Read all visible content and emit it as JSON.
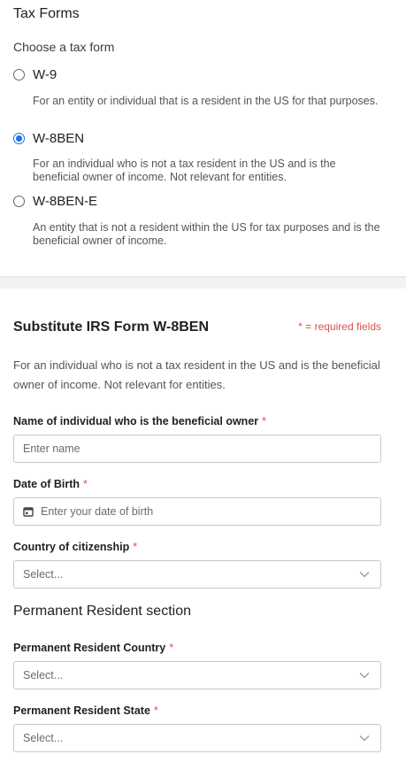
{
  "tax_forms": {
    "title": "Tax Forms",
    "prompt": "Choose a tax form",
    "options": [
      {
        "label": "W-9",
        "description": "For an entity or individual that is a resident in the US for that purposes.",
        "selected": false
      },
      {
        "label": "W-8BEN",
        "description": "For an individual who is not a tax resident in the US and is the beneficial owner of income. Not relevant for entities.",
        "selected": true
      },
      {
        "label": "W-8BEN-E",
        "description": "An entity that is not a resident within the US for tax purposes and is the beneficial owner of income.",
        "selected": false
      }
    ]
  },
  "form": {
    "title": "Substitute IRS Form W-8BEN",
    "required_note": "* = required fields",
    "description": "For an individual who is not a tax resident in the US and is the beneficial owner of income. Not relevant for entities.",
    "required_mark": "*",
    "fields": {
      "name": {
        "label": "Name of individual who is the beneficial owner",
        "placeholder": "Enter name"
      },
      "dob": {
        "label": "Date of Birth",
        "placeholder": "Enter your date of birth"
      },
      "citizenship": {
        "label": "Country of citizenship",
        "value": "Select..."
      }
    },
    "permanent_resident": {
      "title": "Permanent Resident section",
      "country": {
        "label": "Permanent Resident Country",
        "value": "Select..."
      },
      "state": {
        "label": "Permanent Resident State",
        "value": "Select..."
      }
    }
  },
  "colors": {
    "accent": "#1a73e8",
    "required": "#d9534f"
  }
}
